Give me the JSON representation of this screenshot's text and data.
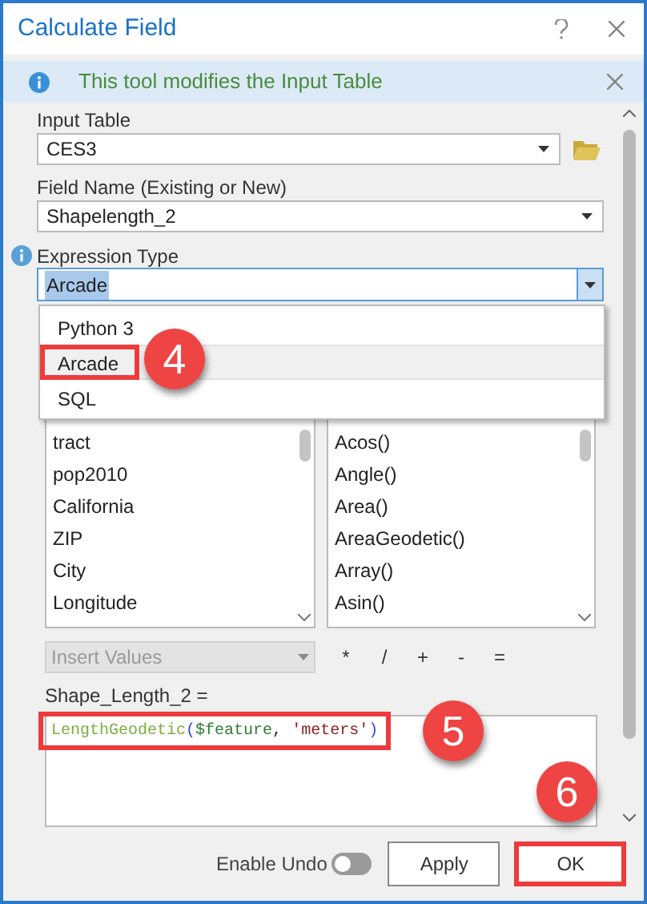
{
  "window": {
    "title": "Calculate Field"
  },
  "info_bar": {
    "message": "This tool modifies the Input Table"
  },
  "input_table": {
    "label": "Input Table",
    "value": "CES3"
  },
  "field_name": {
    "label": "Field Name (Existing or New)",
    "value": "Shapelength_2"
  },
  "expression_type": {
    "label": "Expression Type",
    "value": "Arcade",
    "expanded": true,
    "options": [
      {
        "label": "Python 3",
        "selected": false,
        "highlighted": false
      },
      {
        "label": "Arcade",
        "selected": true,
        "highlighted": true,
        "callout": "4"
      },
      {
        "label": "SQL",
        "selected": false,
        "highlighted": false
      }
    ]
  },
  "fields_list": [
    "tract",
    "pop2010",
    "California",
    "ZIP",
    "City",
    "Longitude"
  ],
  "functions_list": [
    "Acos()",
    "Angle()",
    "Area()",
    "AreaGeodetic()",
    "Array()",
    "Asin()"
  ],
  "insert_values": {
    "placeholder": "Insert Values",
    "disabled": true
  },
  "operators": [
    "*",
    "/",
    "+",
    "-",
    "="
  ],
  "expression": {
    "label": "Shape_Length_2 =",
    "highlighted": true,
    "callout": "5",
    "tokens": [
      {
        "text": "LengthGeodetic",
        "kind": "function"
      },
      {
        "text": "(",
        "kind": "bracket"
      },
      {
        "text": "$feature",
        "kind": "variable"
      },
      {
        "text": ", ",
        "kind": "plain"
      },
      {
        "text": "'meters'",
        "kind": "string"
      },
      {
        "text": ")",
        "kind": "bracket"
      }
    ]
  },
  "enable_undo": {
    "label": "Enable Undo",
    "on": false
  },
  "buttons": [
    {
      "label": "Apply",
      "highlighted": false
    },
    {
      "label": "OK",
      "highlighted": true,
      "callout": "6"
    }
  ]
}
